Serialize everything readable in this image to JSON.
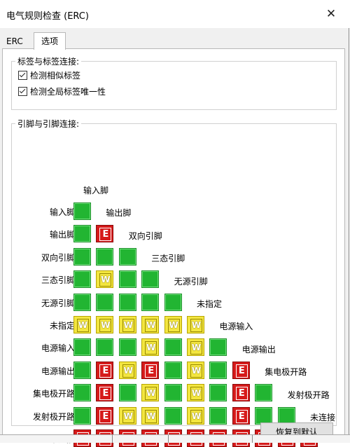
{
  "window": {
    "title": "电气规则检查 (ERC)",
    "close_glyph": "✕"
  },
  "tabs": [
    {
      "label": "ERC"
    },
    {
      "label": "选项"
    }
  ],
  "label_group": {
    "title": "标签与标签连接:",
    "checkboxes": [
      {
        "label": "检测相似标签",
        "checked": true
      },
      {
        "label": "检测全局标签唯一性",
        "checked": true
      }
    ]
  },
  "matrix": {
    "title": "引脚与引脚连接:",
    "pin_types": [
      "输入脚",
      "输出脚",
      "双向引脚",
      "三态引脚",
      "无源引脚",
      "未指定",
      "电源输入",
      "电源输出",
      "集电极开路",
      "发射极开路",
      "未连接"
    ],
    "rows": [
      [
        "ok"
      ],
      [
        "ok",
        "err"
      ],
      [
        "ok",
        "ok",
        "ok"
      ],
      [
        "ok",
        "warn",
        "ok",
        "ok"
      ],
      [
        "ok",
        "ok",
        "ok",
        "ok",
        "ok"
      ],
      [
        "warn",
        "warn",
        "warn",
        "warn",
        "warn",
        "warn"
      ],
      [
        "ok",
        "ok",
        "ok",
        "warn",
        "ok",
        "warn",
        "ok"
      ],
      [
        "ok",
        "err",
        "warn",
        "err",
        "ok",
        "warn",
        "ok",
        "err"
      ],
      [
        "ok",
        "err",
        "ok",
        "warn",
        "ok",
        "warn",
        "ok",
        "err",
        "ok"
      ],
      [
        "ok",
        "err",
        "warn",
        "warn",
        "ok",
        "warn",
        "ok",
        "err",
        "ok",
        "ok"
      ],
      [
        "err",
        "err",
        "err",
        "err",
        "err",
        "err",
        "err",
        "err",
        "err",
        "err",
        "err"
      ]
    ],
    "symbols": {
      "err": "E",
      "warn": "W"
    },
    "colors": {
      "ok": "#22b532",
      "err": "#d61a1a",
      "warn": "#f3e640"
    }
  },
  "reset_button": {
    "label": "恢复到默认"
  }
}
